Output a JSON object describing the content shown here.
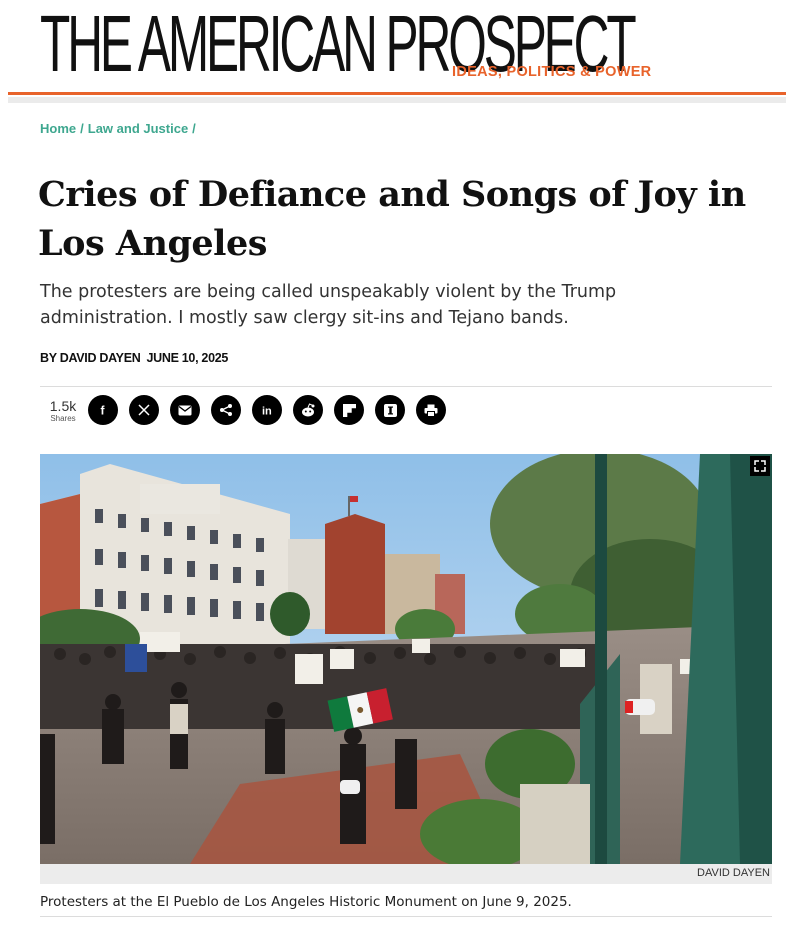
{
  "site": {
    "logo_text": "THE AMERICAN PROSPECT",
    "tagline": "IDEAS, POLITICS & POWER",
    "accent_color": "#e8632b",
    "link_color": "#3ea78f"
  },
  "breadcrumb": {
    "items": [
      "Home",
      "Law and Justice"
    ],
    "separator": "/"
  },
  "article": {
    "title": "Cries of Defiance and Songs of Joy in Los Angeles",
    "dek": "The protesters are being called unspeakably violent by the Trump administration. I mostly saw clergy sit-ins and Tejano bands.",
    "author": "BY DAVID DAYEN",
    "date": "JUNE 10, 2025"
  },
  "share": {
    "count": "1.5k",
    "count_label": "Shares",
    "buttons": [
      {
        "icon": "facebook-icon"
      },
      {
        "icon": "x-twitter-icon"
      },
      {
        "icon": "email-icon"
      },
      {
        "icon": "share-icon"
      },
      {
        "icon": "linkedin-icon"
      },
      {
        "icon": "reddit-icon"
      },
      {
        "icon": "flipboard-icon"
      },
      {
        "icon": "instapaper-icon"
      },
      {
        "icon": "print-icon"
      }
    ]
  },
  "image": {
    "description_icon": "protest-photo",
    "expand_icon": "expand-icon",
    "credit": "DAVID DAYEN",
    "caption": "Protesters at the El Pueblo de Los Angeles Historic Monument on June 9, 2025."
  }
}
